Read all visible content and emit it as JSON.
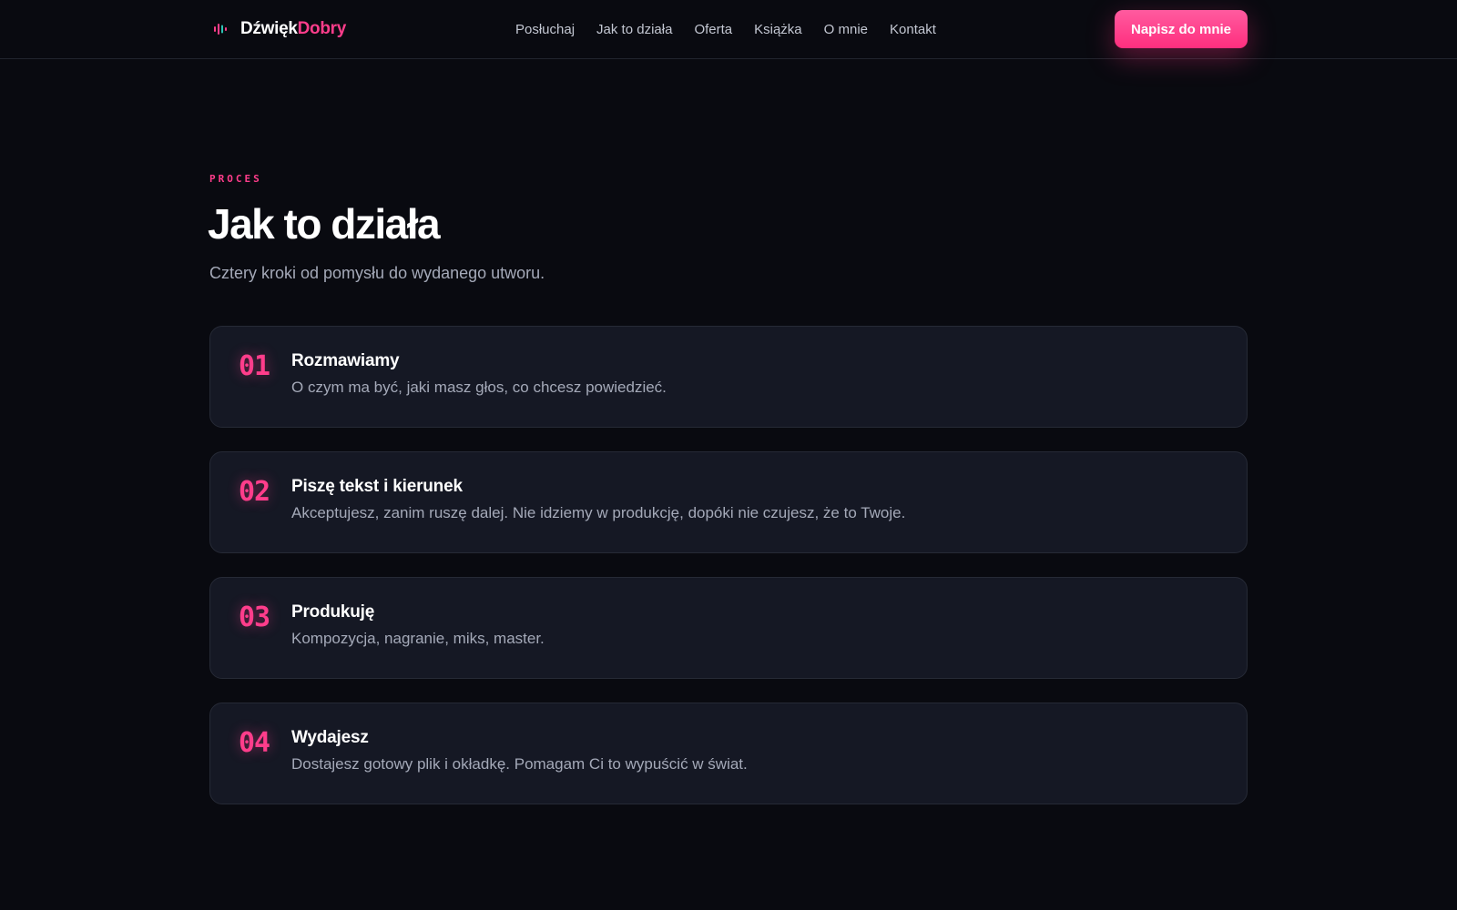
{
  "brand": {
    "name_part1": "Dźwięk",
    "name_part2": "Dobry",
    "icon": "sound-wave-icon",
    "accent_color": "#ff3d8b"
  },
  "nav": {
    "items": [
      "Posłuchaj",
      "Jak to działa",
      "Oferta",
      "Książka",
      "O mnie",
      "Kontakt"
    ],
    "cta_label": "Napisz do mnie"
  },
  "section": {
    "eyebrow": "PROCES",
    "title": "Jak to działa",
    "subtitle": "Cztery kroki od pomysłu do wydanego utworu."
  },
  "steps": [
    {
      "number": "01",
      "title": "Rozmawiamy",
      "description": "O czym ma być, jaki masz głos, co chcesz powiedzieć."
    },
    {
      "number": "02",
      "title": "Piszę tekst i kierunek",
      "description": "Akceptujesz, zanim ruszę dalej. Nie idziemy w produkcję, dopóki nie czujesz, że to Twoje."
    },
    {
      "number": "03",
      "title": "Produkuję",
      "description": "Kompozycja, nagranie, miks, master."
    },
    {
      "number": "04",
      "title": "Wydajesz",
      "description": "Dostajesz gotowy plik i okładkę. Pomagam Ci to wypuścić w świat."
    }
  ]
}
